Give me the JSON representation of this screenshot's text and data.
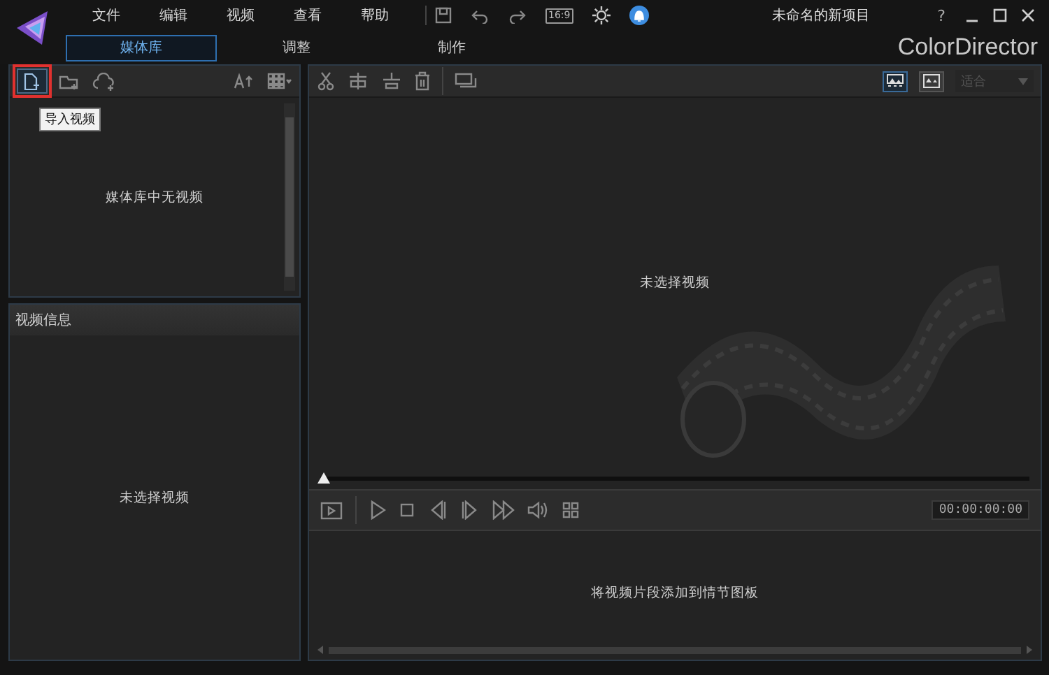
{
  "menu": [
    "文件",
    "编辑",
    "视频",
    "查看",
    "帮助"
  ],
  "aspect_ratio": "16:9",
  "project_title": "未命名的新项目",
  "help": "?",
  "tabs": [
    {
      "label": "媒体库",
      "selected": true
    },
    {
      "label": "调整",
      "selected": false
    },
    {
      "label": "制作",
      "selected": false
    }
  ],
  "brand": "ColorDirector",
  "library": {
    "tooltip": "导入视频",
    "empty_text": "媒体库中无视频"
  },
  "info_panel": {
    "title": "视频信息",
    "empty_text": "未选择视频"
  },
  "preview": {
    "empty_text": "未选择视频",
    "view_modes": [
      {
        "selected": true
      },
      {
        "selected": false
      }
    ],
    "fit_dropdown": {
      "value": "适合",
      "disabled": true
    },
    "scrubber": {
      "level": 0
    },
    "timecode": "00:00:00:00"
  },
  "storyboard": {
    "empty_text": "将视频片段添加到情节图板"
  }
}
